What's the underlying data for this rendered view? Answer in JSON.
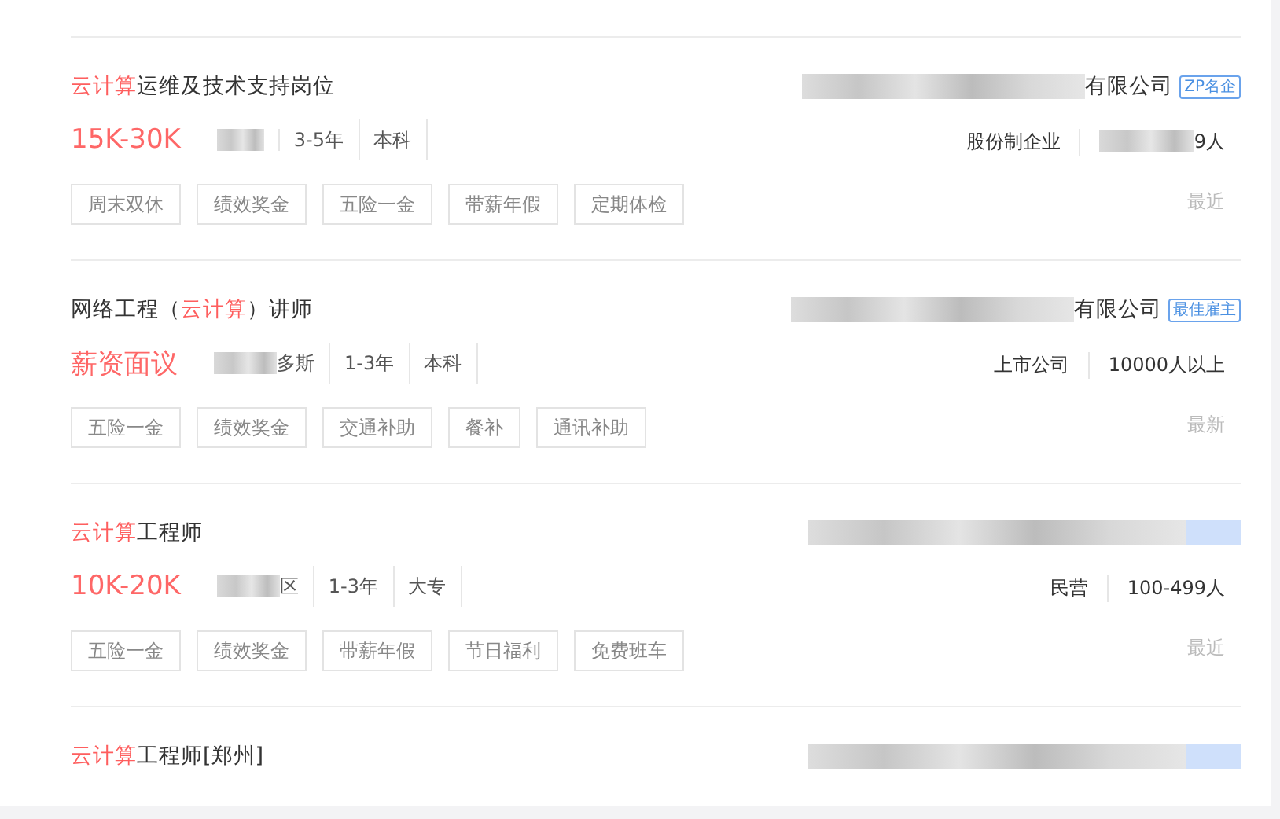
{
  "jobs": [
    {
      "title": [
        {
          "text": "云计算",
          "highlight": true
        },
        {
          "text": "运维及技术支持岗位",
          "highlight": false
        }
      ],
      "salary": "15K-30K",
      "meta": [
        {
          "blurred": true
        },
        {
          "text": "3-5年",
          "blurred": false
        },
        {
          "text": "本科",
          "blurred": false
        }
      ],
      "tags": [
        "周末双休",
        "绩效奖金",
        "五险一金",
        "带薪年假",
        "定期体检"
      ],
      "company": {
        "name": "有限公司",
        "blurred": true,
        "badge": "ZP名企"
      },
      "company_info": [
        {
          "text": "股份制企业",
          "blurred": false
        },
        {
          "text": "9人",
          "blurred": true
        }
      ],
      "time": "最近"
    },
    {
      "title": [
        {
          "text": "网络工程（",
          "highlight": false
        },
        {
          "text": "云计算",
          "highlight": true
        },
        {
          "text": "）讲师",
          "highlight": false
        }
      ],
      "salary": "薪资面议",
      "meta": [
        {
          "text": "多斯",
          "blurred": true
        },
        {
          "text": "1-3年",
          "blurred": false
        },
        {
          "text": "本科",
          "blurred": false
        }
      ],
      "tags": [
        "五险一金",
        "绩效奖金",
        "交通补助",
        "餐补",
        "通讯补助"
      ],
      "company": {
        "name": "有限公司",
        "blurred": true,
        "badge": "最佳雇主"
      },
      "company_info": [
        {
          "text": "上市公司",
          "blurred": false
        },
        {
          "text": "10000人以上",
          "blurred": false
        }
      ],
      "time": "最新"
    },
    {
      "title": [
        {
          "text": "云计算",
          "highlight": true
        },
        {
          "text": "工程师",
          "highlight": false
        }
      ],
      "salary": "10K-20K",
      "meta": [
        {
          "text": "区",
          "blurred": true
        },
        {
          "text": "1-3年",
          "blurred": false
        },
        {
          "text": "大专",
          "blurred": false
        }
      ],
      "tags": [
        "五险一金",
        "绩效奖金",
        "带薪年假",
        "节日福利",
        "免费班车"
      ],
      "company": {
        "blurred": true
      },
      "company_info": [
        {
          "text": "民营",
          "blurred": false
        },
        {
          "text": "100-499人",
          "blurred": false
        }
      ],
      "time": "最近"
    },
    {
      "title": [
        {
          "text": "云计算",
          "highlight": true
        },
        {
          "text": "工程师[郑州]",
          "highlight": false
        }
      ],
      "company": {
        "blurred": true
      }
    }
  ]
}
